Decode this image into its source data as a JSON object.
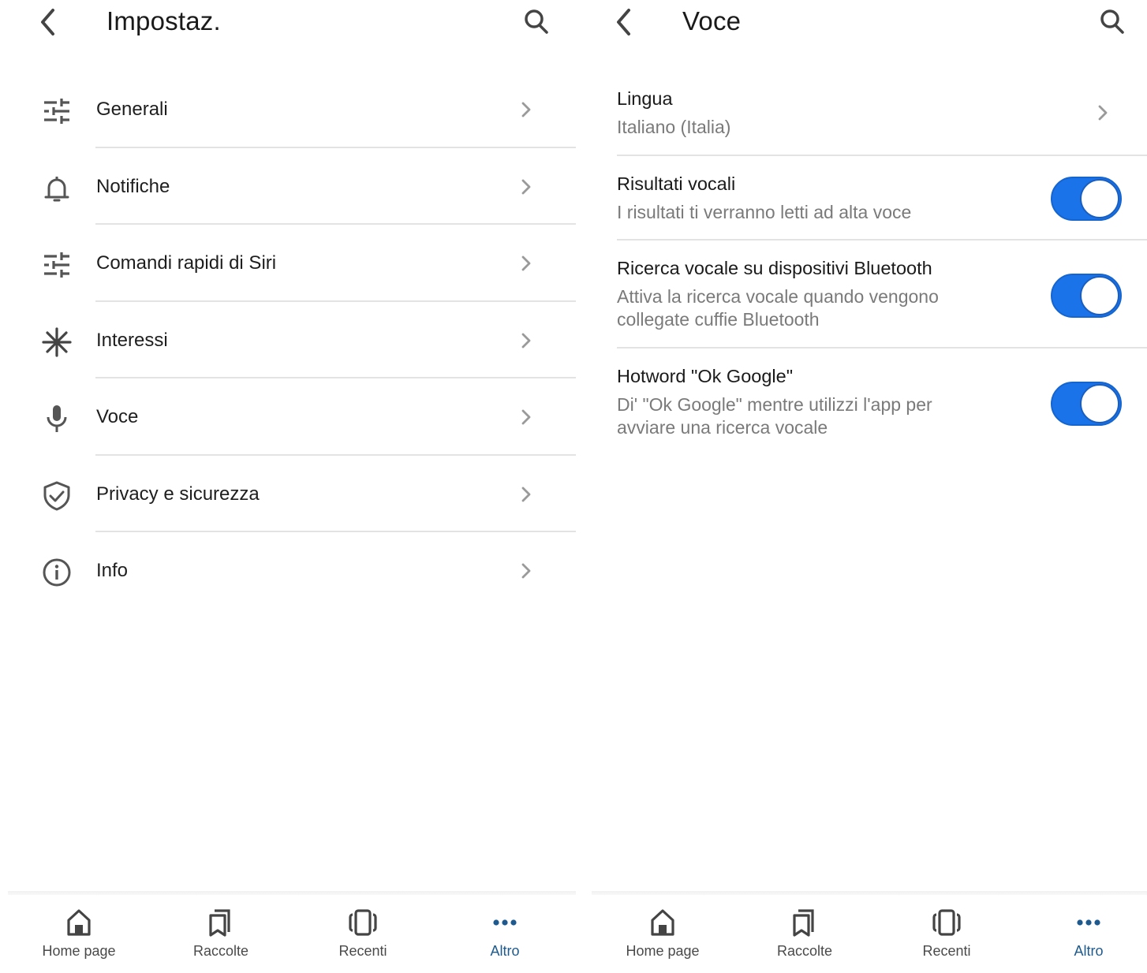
{
  "colors": {
    "accent": "#1a73e8",
    "active_tab": "#1e5a8e",
    "icon": "#555555",
    "divider": "#e3e3e3",
    "secondary_text": "#7a7a7a"
  },
  "left_panel": {
    "header": {
      "back_icon": "chevron-left-icon",
      "title": "Impostaz.",
      "search_icon": "search-icon"
    },
    "menu": [
      {
        "label": "Generali",
        "icon": "sliders-icon"
      },
      {
        "label": "Notifiche",
        "icon": "bell-icon"
      },
      {
        "label": "Comandi rapidi di Siri",
        "icon": "sliders-icon"
      },
      {
        "label": "Interessi",
        "icon": "asterisk-icon"
      },
      {
        "label": "Voce",
        "icon": "microphone-icon"
      },
      {
        "label": "Privacy e sicurezza",
        "icon": "shield-check-icon"
      },
      {
        "label": "Info",
        "icon": "info-icon"
      }
    ]
  },
  "right_panel": {
    "header": {
      "back_icon": "chevron-left-icon",
      "title": "Voce",
      "search_icon": "search-icon"
    },
    "settings": [
      {
        "title": "Lingua",
        "subtitle": "Italiano (Italia)",
        "type": "link"
      },
      {
        "title": "Risultati vocali",
        "subtitle": "I risultati ti verranno letti ad alta voce",
        "type": "toggle",
        "enabled": true
      },
      {
        "title": "Ricerca vocale su dispositivi Bluetooth",
        "subtitle": "Attiva la ricerca vocale quando vengono collegate cuffie Bluetooth",
        "type": "toggle",
        "enabled": true
      },
      {
        "title": "Hotword \"Ok Google\"",
        "subtitle": "Di' \"Ok Google\" mentre utilizzi l'app per avviare una ricerca vocale",
        "type": "toggle",
        "enabled": true
      }
    ]
  },
  "bottom_nav": {
    "items": [
      {
        "label": "Home page",
        "icon": "home-icon",
        "active": false
      },
      {
        "label": "Raccolte",
        "icon": "bookmarks-icon",
        "active": false
      },
      {
        "label": "Recenti",
        "icon": "recent-cards-icon",
        "active": false
      },
      {
        "label": "Altro",
        "icon": "more-dots-icon",
        "active": true
      }
    ]
  }
}
